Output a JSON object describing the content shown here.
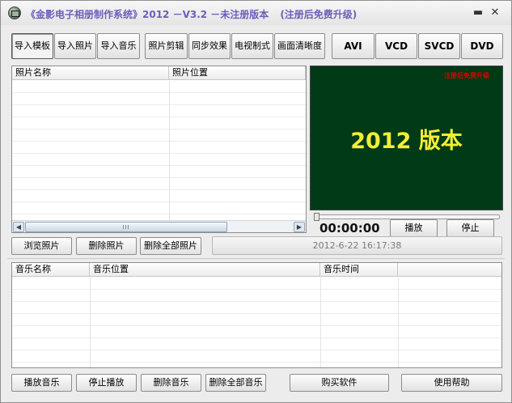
{
  "window": {
    "title": "《金影电子相册制作系统》2012 －V3.2 －未注册版本",
    "title_note": "(注册后免费升级)",
    "minimize_glyph": "▬",
    "close_glyph": "✕"
  },
  "toolbar": {
    "import_template": "导入模板",
    "import_photo": "导入照片",
    "import_music": "导入音乐",
    "photo_crop": "照片剪辑",
    "sync_effect": "同步效果",
    "tv_standard": "电视制式",
    "picture_clarity": "画面清晰度",
    "formats": [
      "AVI",
      "VCD",
      "SVCD",
      "DVD"
    ]
  },
  "photo_list": {
    "columns": [
      "照片名称",
      "照片位置"
    ],
    "rows": [],
    "scroll_left": "◀",
    "scroll_right": "▶"
  },
  "preview": {
    "watermark": "注册后免费升级",
    "caption": "2012  版本",
    "time": "00:00:00",
    "play": "播放",
    "stop": "停止",
    "progress": 0
  },
  "photo_actions": {
    "browse": "浏览照片",
    "delete": "删除照片",
    "delete_all": "删除全部照片",
    "timestamp": "2012-6-22 16:17:38"
  },
  "music_list": {
    "columns": [
      "音乐名称",
      "音乐位置",
      "音乐时间"
    ],
    "rows": []
  },
  "music_actions": {
    "play": "播放音乐",
    "stop": "停止播放",
    "delete": "删除音乐",
    "delete_all": "删除全部音乐",
    "buy": "购买软件",
    "help": "使用帮助"
  },
  "colors": {
    "title_text": "#6a5fb8",
    "preview_bg": "#003a17",
    "preview_caption": "#f2ef36",
    "watermark": "#e00000"
  },
  "icons": {
    "app": "album-app-icon",
    "minimize": "minimize-icon",
    "close": "close-icon"
  }
}
